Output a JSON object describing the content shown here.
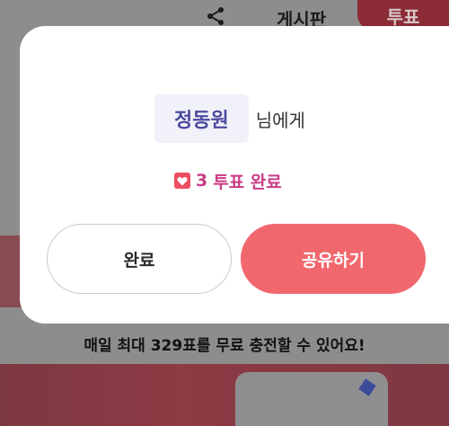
{
  "background": {
    "header": {
      "board_label": "게시판",
      "vote_tab_label": "투표",
      "share_icon": "share-icon"
    },
    "info_text": "매일 최대 329표를 무료 충전할 수 있어요!"
  },
  "modal": {
    "recipient_name": "정동원",
    "recipient_suffix": "님에게",
    "vote_count": "3",
    "vote_status": "투표 완료",
    "heart_icon": "heart-icon",
    "done_button_label": "완료",
    "share_button_label": "공유하기"
  },
  "colors": {
    "accent": "#f0686e",
    "name_text": "#4b4a9e",
    "vote_text": "#c93d86",
    "heart": "#ee4d63"
  }
}
